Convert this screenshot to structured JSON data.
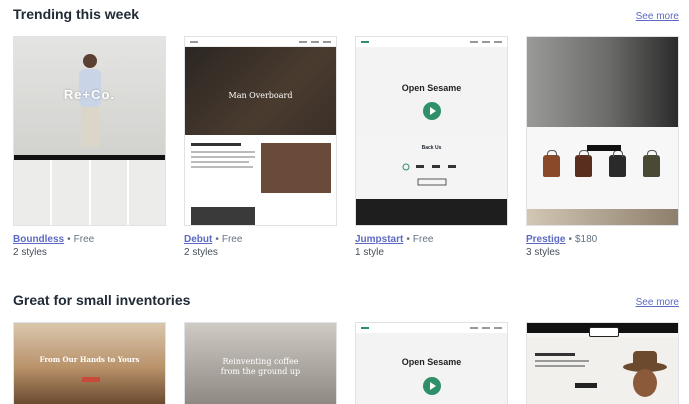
{
  "sections": [
    {
      "title": "Trending this week",
      "see_more": "See more",
      "cards": [
        {
          "name": "Boundless",
          "price": "Free",
          "styles": "2 styles"
        },
        {
          "name": "Debut",
          "price": "Free",
          "styles": "2 styles"
        },
        {
          "name": "Jumpstart",
          "price": "Free",
          "styles": "1 style"
        },
        {
          "name": "Prestige",
          "price": "$180",
          "styles": "3 styles"
        }
      ]
    },
    {
      "title": "Great for small inventories",
      "see_more": "See more"
    }
  ],
  "previews": {
    "boundless_logo": "Re+Co.",
    "debut_hero": "Man Overboard",
    "jumpstart_hero": "Open Sesame",
    "jumpstart_backus": "Back Us",
    "coffee_hero": "From Our Hands to Yours",
    "grey_hero_line1": "Reinventing coffee",
    "grey_hero_line2": "from the ground up",
    "jumpstart2_hero": "Open Sesame"
  },
  "colors": {
    "link": "#5c6ac4",
    "heading": "#212b36",
    "muted": "#637381",
    "jumpstart_play": "#2f8f6a"
  }
}
